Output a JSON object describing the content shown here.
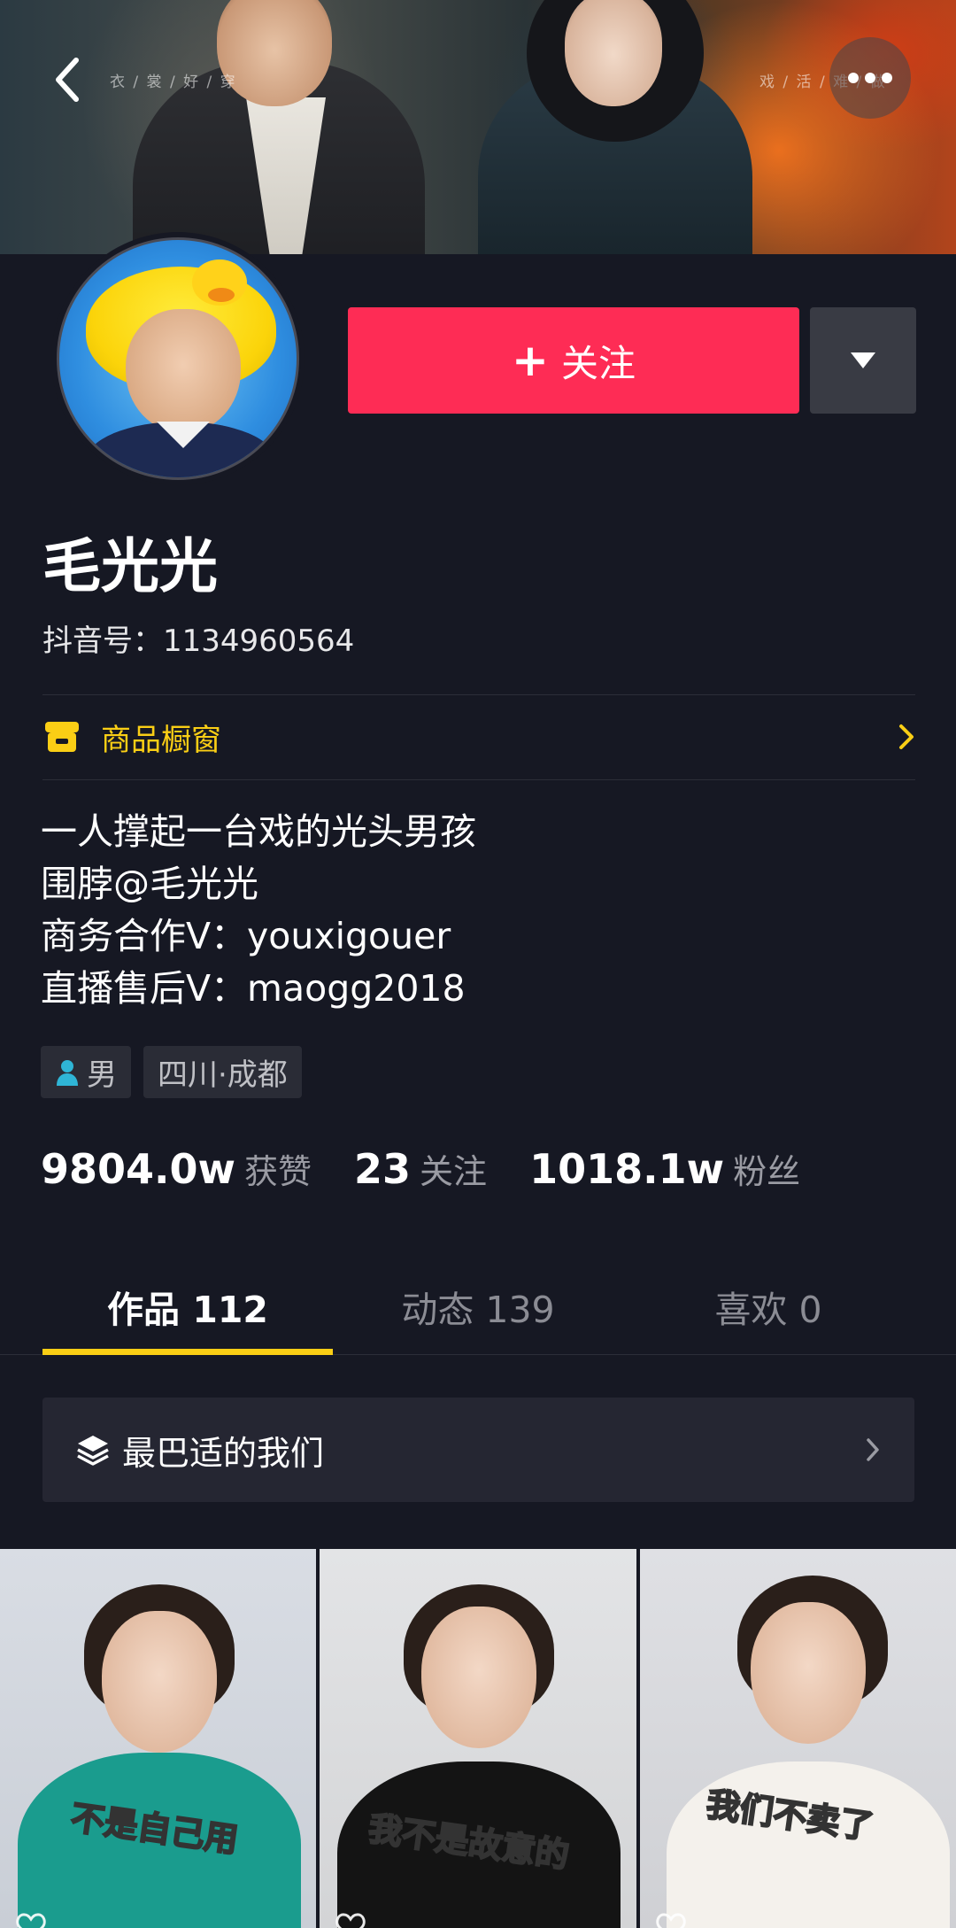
{
  "banner": {
    "caption_left": "衣 / 裳 / 好 / 穿",
    "caption_right": "戏 / 活 / 难 / 做"
  },
  "header": {
    "back_icon": "chevron-left-icon",
    "more_icon": "more-dots-icon"
  },
  "profile": {
    "follow_label": "关注",
    "name": "毛光光",
    "douyin_id": "抖音号：1134960564",
    "shop_label": "商品橱窗",
    "bio": [
      "一人撑起一台戏的光头男孩",
      "围脖@毛光光",
      "商务合作V：youxigouer",
      "直播售后V：maogg2018"
    ],
    "tags": {
      "gender": "男",
      "location": "四川·成都"
    },
    "stats": {
      "likes_value": "9804.0w",
      "likes_label": "获赞",
      "following_value": "23",
      "following_label": "关注",
      "followers_value": "1018.1w",
      "followers_label": "粉丝"
    }
  },
  "tabs": [
    {
      "label": "作品 112",
      "active": true
    },
    {
      "label": "动态 139",
      "active": false
    },
    {
      "label": "喜欢 0",
      "active": false
    }
  ],
  "collection": {
    "label": "最巴适的我们"
  },
  "videos": [
    {
      "caption": "不是自己用",
      "likes": ""
    },
    {
      "caption": "我不是故意的",
      "likes": ""
    },
    {
      "caption": "我们不卖了",
      "likes": ""
    }
  ],
  "colors": {
    "background": "#161823",
    "follow_button": "#fe2c55",
    "accent_yellow": "#face15",
    "secondary_text": "#9a9ba3"
  }
}
